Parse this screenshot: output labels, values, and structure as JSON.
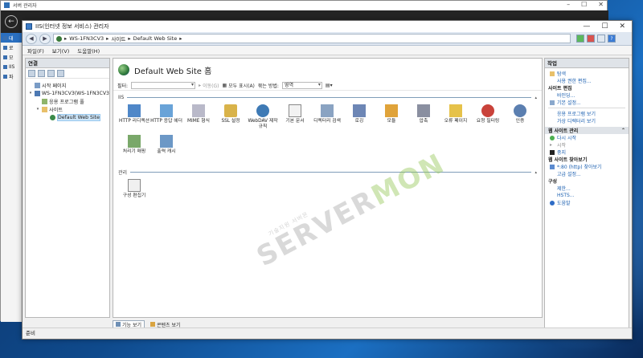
{
  "bg_window": {
    "title": "서버 관리자",
    "side_items": [
      "대",
      "로",
      "모",
      "IIS",
      "파"
    ]
  },
  "iis_window": {
    "title": "IIS(인터넷 정보 서비스) 관리자",
    "controls": [
      "—",
      "☐",
      "✕"
    ]
  },
  "address": {
    "segments": [
      "WS-1FN3CV3",
      "사이트",
      "Default Web Site"
    ],
    "separator": "▸"
  },
  "menu": [
    "파일(F)",
    "보기(V)",
    "도움말(H)"
  ],
  "connections": {
    "header": "연결",
    "tree": [
      {
        "label": "시작 페이지",
        "level": 0
      },
      {
        "label": "WS-1FN3CV3(WS-1FN3CV3",
        "level": 0
      },
      {
        "label": "응용 프로그램 풀",
        "level": 1
      },
      {
        "label": "사이트",
        "level": 1
      },
      {
        "label": "Default Web Site",
        "level": 2
      }
    ]
  },
  "center": {
    "title": "Default Web Site 홈",
    "filter_label": "필터:",
    "go_label": "이동(G)",
    "show_all_label": "모두 표시(A)",
    "group_by_label": "묶는 방법:",
    "group_by_value": "영역",
    "group_iis": "IIS",
    "group_manage": "관리",
    "features_iis": [
      {
        "label": "HTTP 리디렉션",
        "icon": "http-redirect-icon"
      },
      {
        "label": "HTTP 응답 헤더",
        "icon": "http-response-headers-icon"
      },
      {
        "label": "MIME 형식",
        "icon": "mime-types-icon"
      },
      {
        "label": "SSL 설정",
        "icon": "ssl-settings-icon"
      },
      {
        "label": "WebDAV 제작 규칙",
        "icon": "webdav-icon"
      },
      {
        "label": "기본 문서",
        "icon": "default-document-icon"
      },
      {
        "label": "디렉터리 검색",
        "icon": "directory-browsing-icon"
      },
      {
        "label": "로깅",
        "icon": "logging-icon"
      },
      {
        "label": "모듈",
        "icon": "modules-icon"
      },
      {
        "label": "압축",
        "icon": "compression-icon"
      },
      {
        "label": "오류 페이지",
        "icon": "error-pages-icon"
      },
      {
        "label": "요청 필터링",
        "icon": "request-filtering-icon"
      },
      {
        "label": "인증",
        "icon": "authentication-icon"
      },
      {
        "label": "처리기 매핑",
        "icon": "handler-mappings-icon"
      },
      {
        "label": "출력 캐시",
        "icon": "output-caching-icon"
      }
    ],
    "features_manage": [
      {
        "label": "구성 편집기",
        "icon": "configuration-editor-icon"
      }
    ]
  },
  "view_tabs": {
    "features": "기능 보기",
    "content": "콘텐츠 보기"
  },
  "status": "준비",
  "actions": {
    "header": "작업",
    "items_top": [
      {
        "label": "탐색",
        "type": "link"
      },
      {
        "label": "사용 권한 편집...",
        "type": "link"
      }
    ],
    "site_edit_title": "사이트 편집",
    "site_edit": [
      "바인딩...",
      "기본 설정..."
    ],
    "site_view": [
      "응용 프로그램 보기",
      "가상 디렉터리 보기"
    ],
    "manage_title": "웹 사이트 관리",
    "manage_items": [
      {
        "label": "다시 시작",
        "state": "enabled"
      },
      {
        "label": "시작",
        "state": "disabled"
      },
      {
        "label": "중지",
        "state": "plain"
      }
    ],
    "browse_title": "웹 사이트 찾아보기",
    "browse_item": "*:80 (http) 찾아보기",
    "advanced": "고급 설정...",
    "config_title": "구성",
    "config_items": [
      "제한...",
      "HSTS..."
    ],
    "help": "도움말"
  },
  "watermark": {
    "main": "SERVER",
    "accent": "MON",
    "small": "기술지원 서버몬"
  }
}
